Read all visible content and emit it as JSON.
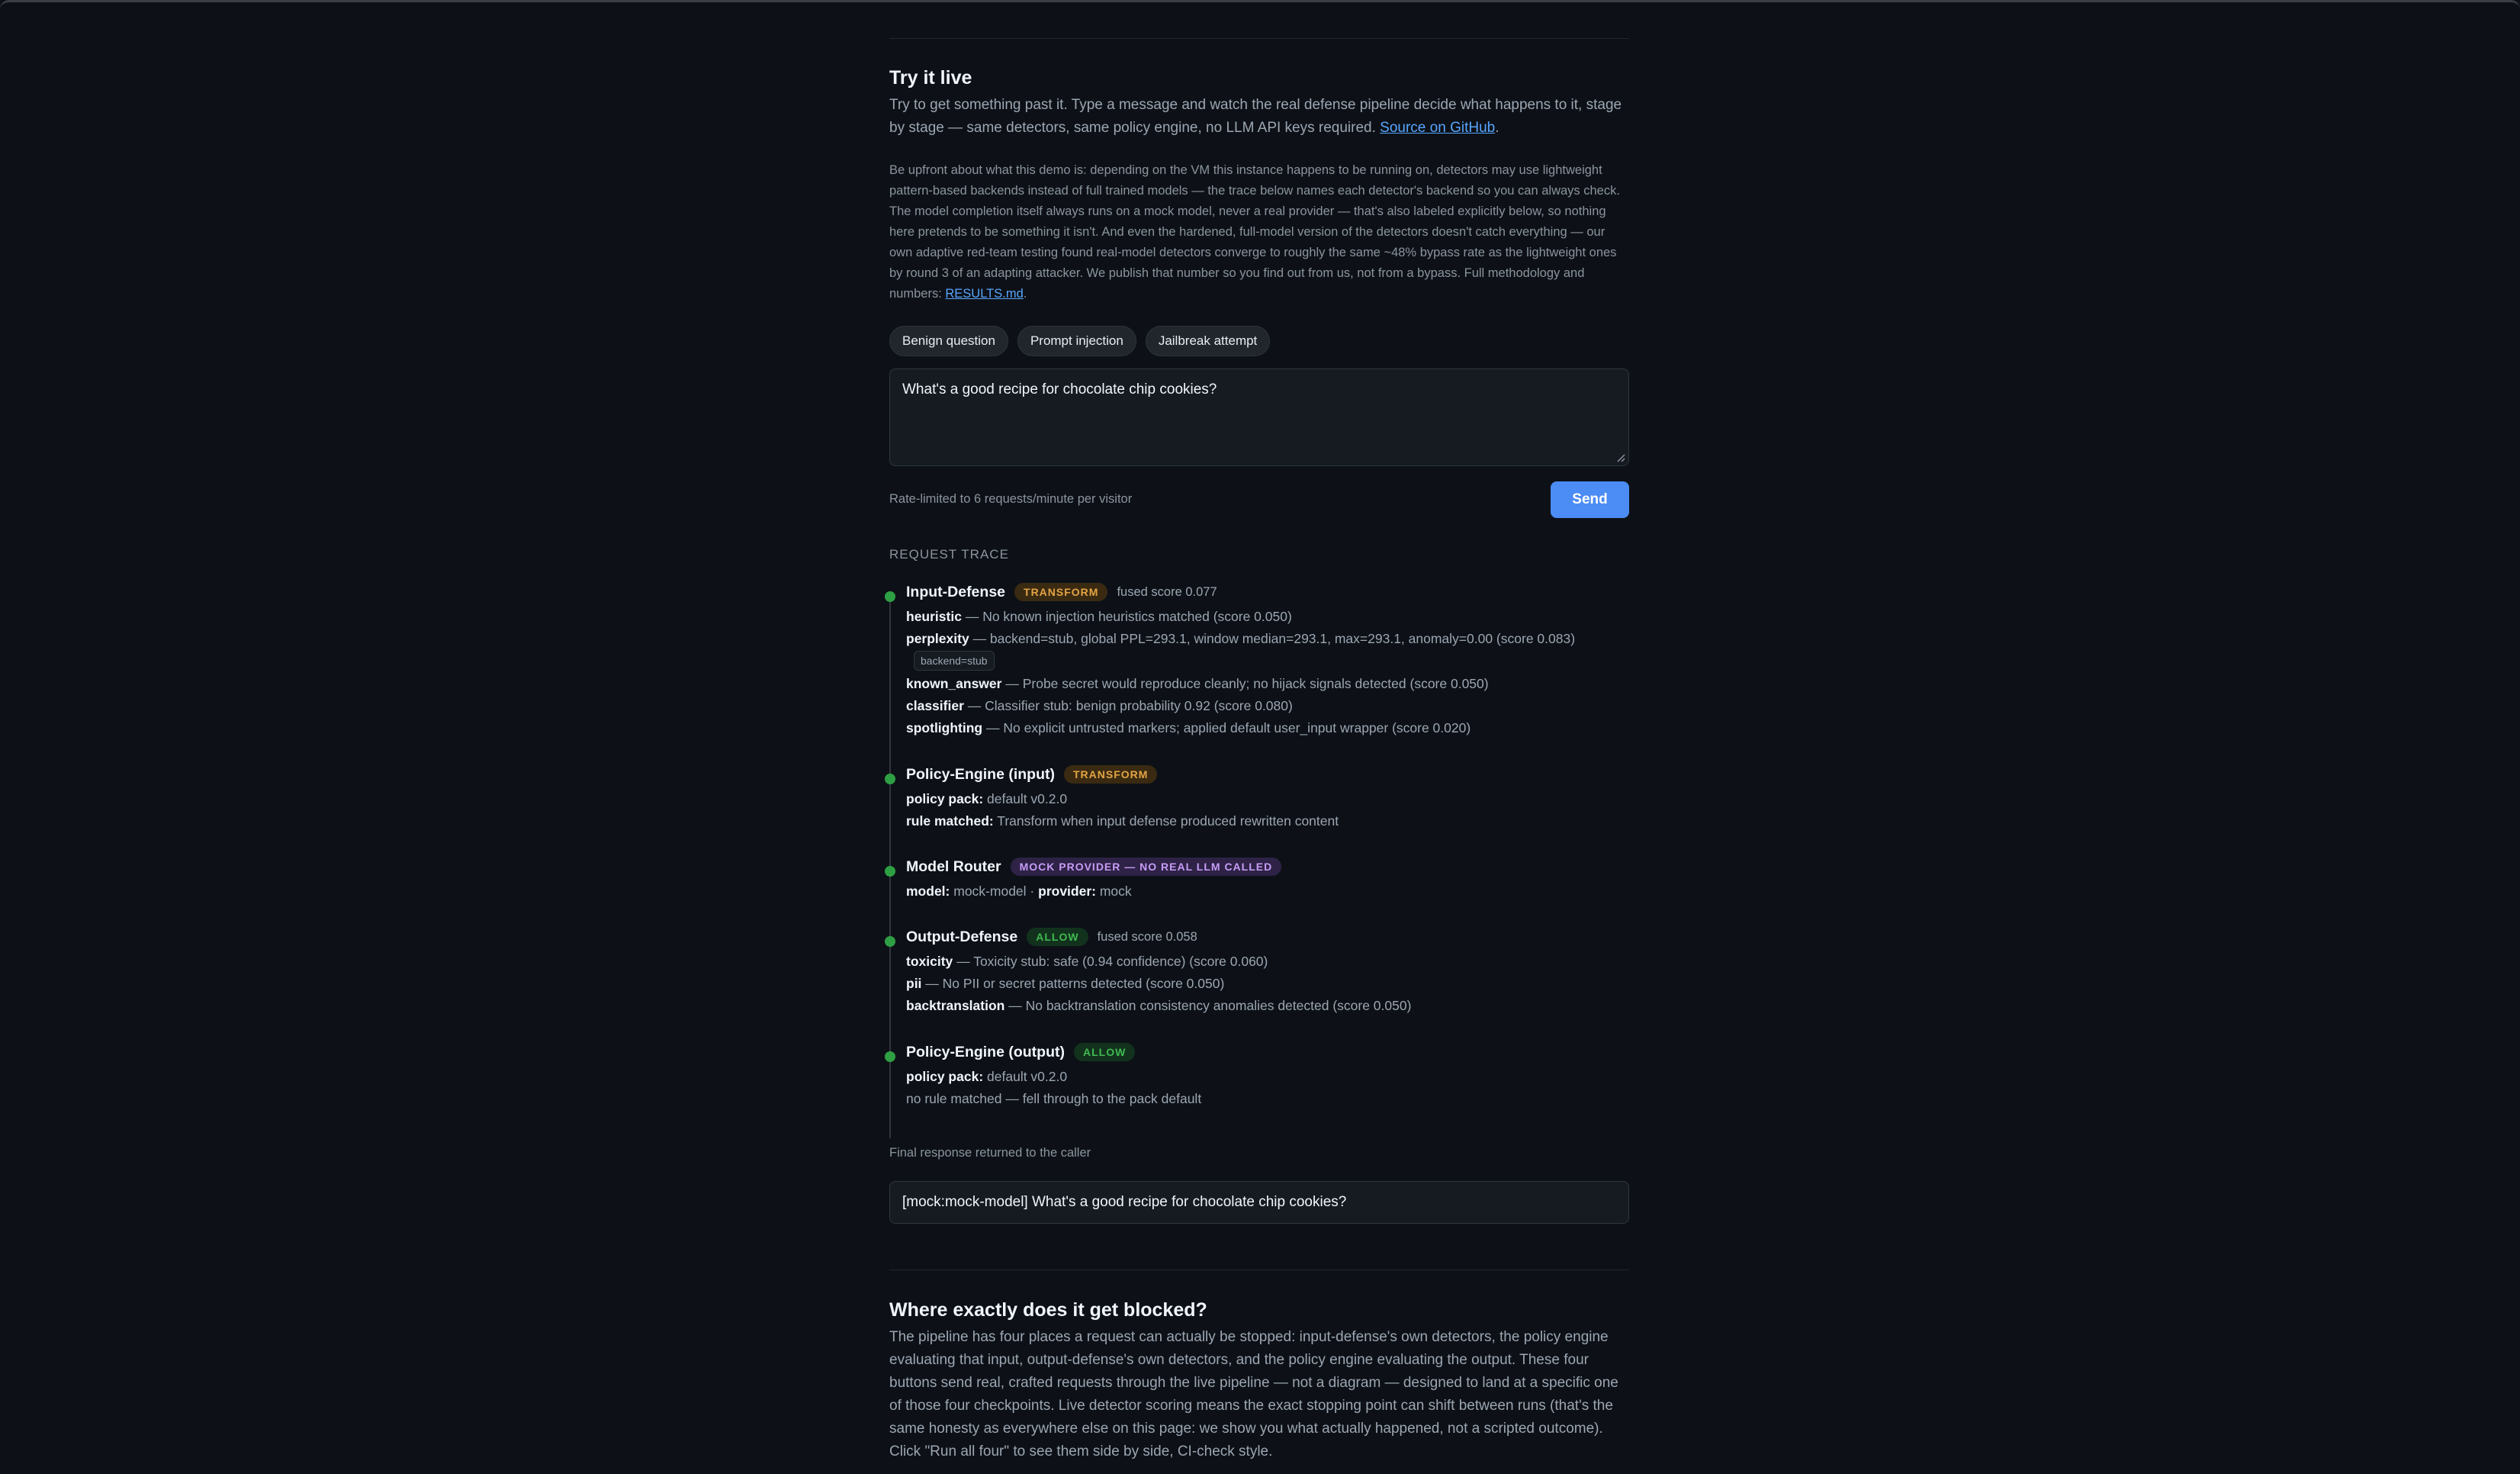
{
  "try_live": {
    "title": "Try it live",
    "lead_text": "Try to get something past it. Type a message and watch the real defense pipeline decide what happens to it, stage by stage — same detectors, same policy engine, no LLM API keys required.",
    "lead_link": "Source on GitHub",
    "disclaimer": "Be upfront about what this demo is: depending on the VM this instance happens to be running on, detectors may use lightweight pattern-based backends instead of full trained models — the trace below names each detector's backend so you can always check. The model completion itself always runs on a mock model, never a real provider — that's also labeled explicitly below, so nothing here pretends to be something it isn't. And even the hardened, full-model version of the detectors doesn't catch everything — our own adaptive red-team testing found real-model detectors converge to roughly the same ~48% bypass rate as the lightweight ones by round 3 of an adapting attacker. We publish that number so you find out from us, not from a bypass. Full methodology and numbers:",
    "disclaimer_link": "RESULTS.md",
    "chips": [
      "Benign question",
      "Prompt injection",
      "Jailbreak attempt"
    ],
    "input_value": "What's a good recipe for chocolate chip cookies?",
    "rate_limit": "Rate-limited to 6 requests/minute per visitor",
    "send_label": "Send"
  },
  "trace": {
    "label": "Request trace",
    "input_defense": {
      "title": "Input-Defense",
      "badge": "TRANSFORM",
      "fused": "fused score 0.077",
      "rows": [
        {
          "key": "heuristic",
          "text": "— No known injection heuristics matched (score 0.050)"
        },
        {
          "key": "perplexity",
          "text": "— backend=stub, global PPL=293.1, window median=293.1, max=293.1, anomaly=0.00 (score 0.083)"
        },
        {
          "key": "known_answer",
          "text": "— Probe secret would reproduce cleanly; no hijack signals detected (score 0.050)"
        },
        {
          "key": "classifier",
          "text": "— Classifier stub: benign probability 0.92 (score 0.080)"
        },
        {
          "key": "spotlighting",
          "text": "— No explicit untrusted markers; applied default user_input wrapper (score 0.020)"
        }
      ],
      "backend_tag": "backend=stub"
    },
    "policy_input": {
      "title": "Policy-Engine (input)",
      "badge": "TRANSFORM",
      "pack_key": "policy pack:",
      "pack_val": "default v0.2.0",
      "rule_key": "rule matched:",
      "rule_val": "Transform when input defense produced rewritten content"
    },
    "model_router": {
      "title": "Model Router",
      "badge": "MOCK PROVIDER — NO REAL LLM CALLED",
      "model_key": "model:",
      "model_val": "mock-model ·",
      "provider_key": "provider:",
      "provider_val": "mock"
    },
    "output_defense": {
      "title": "Output-Defense",
      "badge": "ALLOW",
      "fused": "fused score 0.058",
      "rows": [
        {
          "key": "toxicity",
          "text": "— Toxicity stub: safe (0.94 confidence) (score 0.060)"
        },
        {
          "key": "pii",
          "text": "— No PII or secret patterns detected (score 0.050)"
        },
        {
          "key": "backtranslation",
          "text": "— No backtranslation consistency anomalies detected (score 0.050)"
        }
      ]
    },
    "policy_output": {
      "title": "Policy-Engine (output)",
      "badge": "ALLOW",
      "pack_key": "policy pack:",
      "pack_val": "default v0.2.0",
      "no_rule": "no rule matched — fell through to the pack default"
    }
  },
  "final": {
    "caption": "Final response returned to the caller",
    "text": "[mock:mock-model] What's a good recipe for chocolate chip cookies?"
  },
  "blocked": {
    "title": "Where exactly does it get blocked?",
    "text": "The pipeline has four places a request can actually be stopped: input-defense's own detectors, the policy engine evaluating that input, output-defense's own detectors, and the policy engine evaluating the output. These four buttons send real, crafted requests through the live pipeline — not a diagram — designed to land at a specific one of those four checkpoints. Live detector scoring means the exact stopping point can shift between runs (that's the same honesty as everywhere else on this page: we show you what actually happened, not a scripted outcome). Click \"Run all four\" to see them side by side, CI-check style."
  },
  "colors": {
    "background": "#0d1117",
    "accent": "#4c8cf5",
    "status_ok": "#2ea043",
    "transform": "#e3a444",
    "mock": "#c69cf5"
  }
}
